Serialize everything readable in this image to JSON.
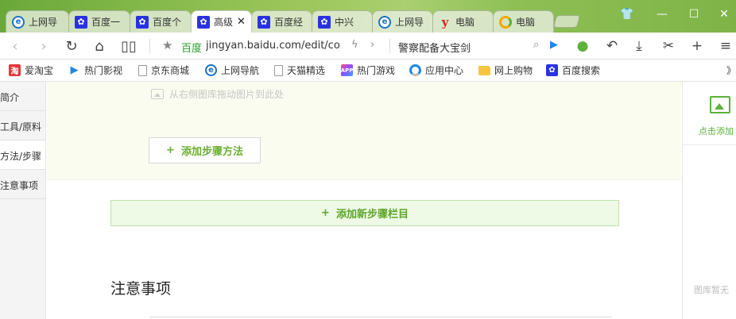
{
  "tabs": [
    {
      "label": "上网导",
      "icon": "ie-icon",
      "active": false
    },
    {
      "label": "百度一",
      "icon": "baidu-paw-icon",
      "active": false
    },
    {
      "label": "百度个",
      "icon": "baidu-paw-icon",
      "active": false
    },
    {
      "label": "高级",
      "icon": "baidu-paw-icon",
      "active": true,
      "close": "✕"
    },
    {
      "label": "百度经",
      "icon": "baidu-paw-icon",
      "active": false
    },
    {
      "label": "中兴",
      "icon": "baidu-paw-icon",
      "active": false
    },
    {
      "label": "上网导",
      "icon": "ie-icon",
      "active": false
    },
    {
      "label": "电脑",
      "icon": "y-icon",
      "active": false
    },
    {
      "label": "电脑",
      "icon": "ring-icon",
      "active": false
    }
  ],
  "window": {
    "skin": "👕",
    "minimize": "—",
    "maximize": "☐",
    "close": "✕"
  },
  "address": {
    "site_label": "百度",
    "url": "jingyan.baidu.com/edit/cor",
    "search_query": "警察配备大宝剑"
  },
  "bookmarks": [
    {
      "label": "爱淘宝",
      "icon": "taobao-icon",
      "glyph": "淘"
    },
    {
      "label": "热门影视",
      "icon": "play-icon",
      "glyph": "▶"
    },
    {
      "label": "京东商城",
      "icon": "page-icon",
      "glyph": ""
    },
    {
      "label": "上网导航",
      "icon": "ie-icon",
      "glyph": "e"
    },
    {
      "label": "天猫精选",
      "icon": "page-icon",
      "glyph": ""
    },
    {
      "label": "热门游戏",
      "icon": "game-icon",
      "glyph": "APP"
    },
    {
      "label": "应用中心",
      "icon": "app-center-icon",
      "glyph": ""
    },
    {
      "label": "网上购物",
      "icon": "folder-icon",
      "glyph": ""
    },
    {
      "label": "百度搜索",
      "icon": "baidu-paw-icon",
      "glyph": "✿"
    }
  ],
  "bookmarks_more": "》",
  "left_nav": [
    {
      "label": "简介",
      "active": false
    },
    {
      "label": "工具/原料",
      "active": false
    },
    {
      "label": "方法/步骤",
      "active": true
    },
    {
      "label": "注意事项",
      "active": false
    }
  ],
  "editor": {
    "drag_hint": "从右侧图库拖动图片到此处",
    "add_method": "添加步骤方法",
    "add_section": "添加新步骤栏目",
    "plus": "+",
    "notes_title": "注意事项"
  },
  "right_panel": {
    "upload_label": "点击添加",
    "empty_text": "图库暂无"
  }
}
